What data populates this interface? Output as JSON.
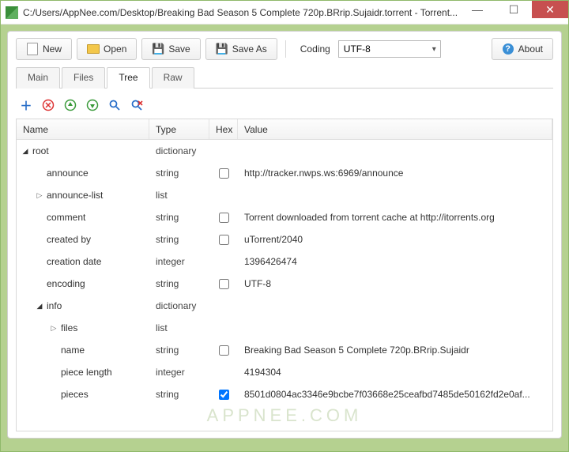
{
  "window": {
    "title": "C:/Users/AppNee.com/Desktop/Breaking Bad Season 5 Complete 720p.BRrip.Sujaidr.torrent - Torrent..."
  },
  "toolbar": {
    "new_label": "New",
    "open_label": "Open",
    "save_label": "Save",
    "saveas_label": "Save As",
    "coding_label": "Coding",
    "coding_value": "UTF-8",
    "about_label": "About"
  },
  "tabs": {
    "items": [
      "Main",
      "Files",
      "Tree",
      "Raw"
    ],
    "active": "Tree"
  },
  "columns": {
    "name": "Name",
    "type": "Type",
    "hex": "Hex",
    "value": "Value"
  },
  "tree": [
    {
      "depth": 0,
      "expand": "open",
      "name": "root",
      "type": "dictionary",
      "hex": null,
      "value": ""
    },
    {
      "depth": 1,
      "expand": null,
      "name": "announce",
      "type": "string",
      "hex": false,
      "value": "http://tracker.nwps.ws:6969/announce"
    },
    {
      "depth": 1,
      "expand": "closed",
      "name": "announce-list",
      "type": "list",
      "hex": null,
      "value": ""
    },
    {
      "depth": 1,
      "expand": null,
      "name": "comment",
      "type": "string",
      "hex": false,
      "value": "Torrent downloaded from torrent cache at http://itorrents.org"
    },
    {
      "depth": 1,
      "expand": null,
      "name": "created by",
      "type": "string",
      "hex": false,
      "value": "uTorrent/2040"
    },
    {
      "depth": 1,
      "expand": null,
      "name": "creation date",
      "type": "integer",
      "hex": null,
      "value": "1396426474"
    },
    {
      "depth": 1,
      "expand": null,
      "name": "encoding",
      "type": "string",
      "hex": false,
      "value": "UTF-8"
    },
    {
      "depth": 1,
      "expand": "open",
      "name": "info",
      "type": "dictionary",
      "hex": null,
      "value": ""
    },
    {
      "depth": 2,
      "expand": "closed",
      "name": "files",
      "type": "list",
      "hex": null,
      "value": ""
    },
    {
      "depth": 2,
      "expand": null,
      "name": "name",
      "type": "string",
      "hex": false,
      "value": "Breaking Bad Season 5 Complete 720p.BRrip.Sujaidr"
    },
    {
      "depth": 2,
      "expand": null,
      "name": "piece length",
      "type": "integer",
      "hex": null,
      "value": "4194304"
    },
    {
      "depth": 2,
      "expand": null,
      "name": "pieces",
      "type": "string",
      "hex": true,
      "value": "8501d0804ac3346e9bcbe7f03668e25ceafbd7485de50162fd2e0af..."
    }
  ],
  "watermark": "APPNEE.COM"
}
